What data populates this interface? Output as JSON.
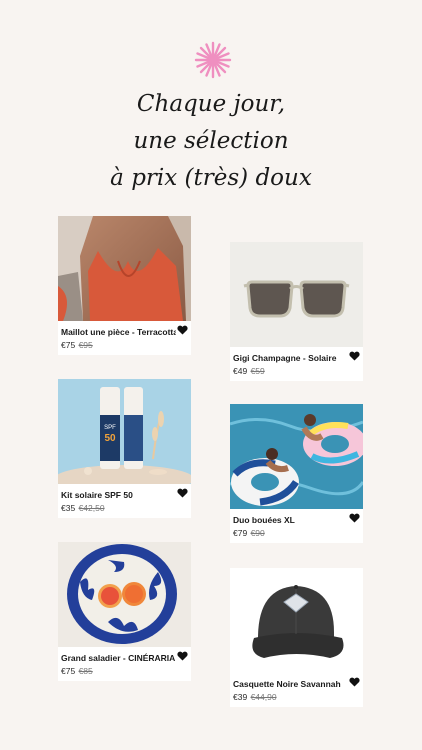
{
  "brand": {
    "logo_icon": "asterisk-flower-icon",
    "logo_color": "#ef8fc0"
  },
  "headline": [
    "Chaque jour,",
    "une sélection",
    "à prix (très) doux"
  ],
  "products": [
    {
      "name": "Maillot une pièce - Terracotta",
      "price": "€75",
      "old_price": "€95",
      "image": "swimsuit-photo"
    },
    {
      "name": "Gigi Champagne - Solaire",
      "price": "€49",
      "old_price": "€59",
      "image": "sunglasses-photo"
    },
    {
      "name": "Kit solaire SPF 50",
      "price": "€35",
      "old_price": "€42,50",
      "image": "sunscreen-photo",
      "image_text": [
        "SPF",
        "50"
      ]
    },
    {
      "name": "Duo bouées XL",
      "price": "€79",
      "old_price": "€90",
      "image": "pool-floats-photo"
    },
    {
      "name": "Grand saladier - CINÉRARIA",
      "price": "€75",
      "old_price": "€85",
      "image": "salad-bowl-photo"
    },
    {
      "name": "Casquette Noire Savannah",
      "price": "€39",
      "old_price": "€44,90",
      "image": "black-cap-photo"
    }
  ],
  "colors": {
    "background": "#f8f4f1",
    "heart": "#111111"
  }
}
